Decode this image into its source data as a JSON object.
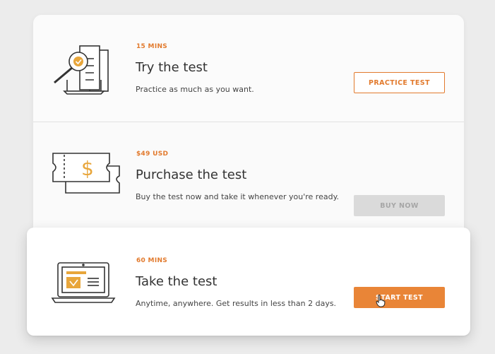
{
  "cards": [
    {
      "kicker": "15 MINS",
      "title": "Try the test",
      "description": "Practice as much as you want.",
      "button_label": "PRACTICE TEST",
      "icon": "magnifier-document-icon"
    },
    {
      "kicker": "$49 USD",
      "title": "Purchase the test",
      "description": "Buy the test now and take it whenever you're ready.",
      "button_label": "BUY NOW",
      "button_state": "disabled",
      "icon": "ticket-dollar-icon"
    },
    {
      "kicker": "60 MINS",
      "title": "Take the test",
      "description": "Anytime, anywhere. Get results in less than 2 days.",
      "button_label": "START TEST",
      "icon": "laptop-certificate-icon"
    }
  ],
  "colors": {
    "accent": "#e27a2d",
    "button_primary": "#e98537",
    "button_disabled": "#dadada"
  }
}
